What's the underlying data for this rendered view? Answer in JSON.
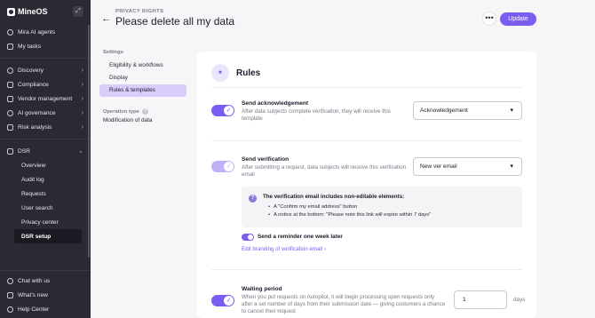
{
  "brand": {
    "name": "MineOS"
  },
  "sidebar": {
    "top_items": [
      {
        "label": "Mira AI agents"
      },
      {
        "label": "My tasks"
      }
    ],
    "sections": [
      {
        "label": "Discovery"
      },
      {
        "label": "Compliance"
      },
      {
        "label": "Vendor management"
      },
      {
        "label": "AI governance"
      },
      {
        "label": "Risk analysis"
      }
    ],
    "dsr": {
      "label": "DSR",
      "items": [
        {
          "label": "Overview"
        },
        {
          "label": "Audit log"
        },
        {
          "label": "Requests"
        },
        {
          "label": "User search"
        },
        {
          "label": "Privacy center"
        },
        {
          "label": "DSR setup"
        }
      ]
    },
    "bottom_items": [
      {
        "label": "Chat with us"
      },
      {
        "label": "What's new"
      },
      {
        "label": "Help Center"
      }
    ]
  },
  "header": {
    "eyebrow": "PRIVACY RIGHTS",
    "title": "Please delete all my data",
    "more_label": "•••",
    "update_label": "Update"
  },
  "settings_nav": {
    "heading": "Settings",
    "links": [
      {
        "label": "Eligibility & workflows"
      },
      {
        "label": "Display"
      },
      {
        "label": "Rules & templates"
      }
    ],
    "operation_type_label": "Operation type",
    "operation_type_value": "Modification of data"
  },
  "rules": {
    "title": "Rules",
    "ack": {
      "title": "Send acknowledgement",
      "desc_line1": "After data subjects complete verification, they will receive this",
      "desc_line2": "template",
      "select_value": "Acknowledgement"
    },
    "verification": {
      "title": "Send verification",
      "desc_line1": "After submitting a request, data subjects will receive this verification",
      "desc_line2": "email",
      "select_value": "New ver email"
    },
    "info": {
      "title": "The verification email includes non-editable elements:",
      "item1": "A \"Confirm my email address\" button",
      "item2": "A notice at the bottom: \"Please note this link will expire within 7 days\""
    },
    "reminder_label": "Send a reminder one week later",
    "branding_link": "Edit branding of verification email ›",
    "waiting": {
      "title": "Waiting period",
      "desc_line1": "When you put requests on Autopilot, it will begin processing open requests only",
      "desc_line2": "after a set number of days from their submission date — giving customers a chance",
      "desc_line3": "to cancel their request",
      "value": "1",
      "unit": "days"
    }
  },
  "colors": {
    "accent": "#7b5cf0",
    "sidebar_bg": "#2a2a35",
    "active_nav": "#d9cdfb"
  }
}
